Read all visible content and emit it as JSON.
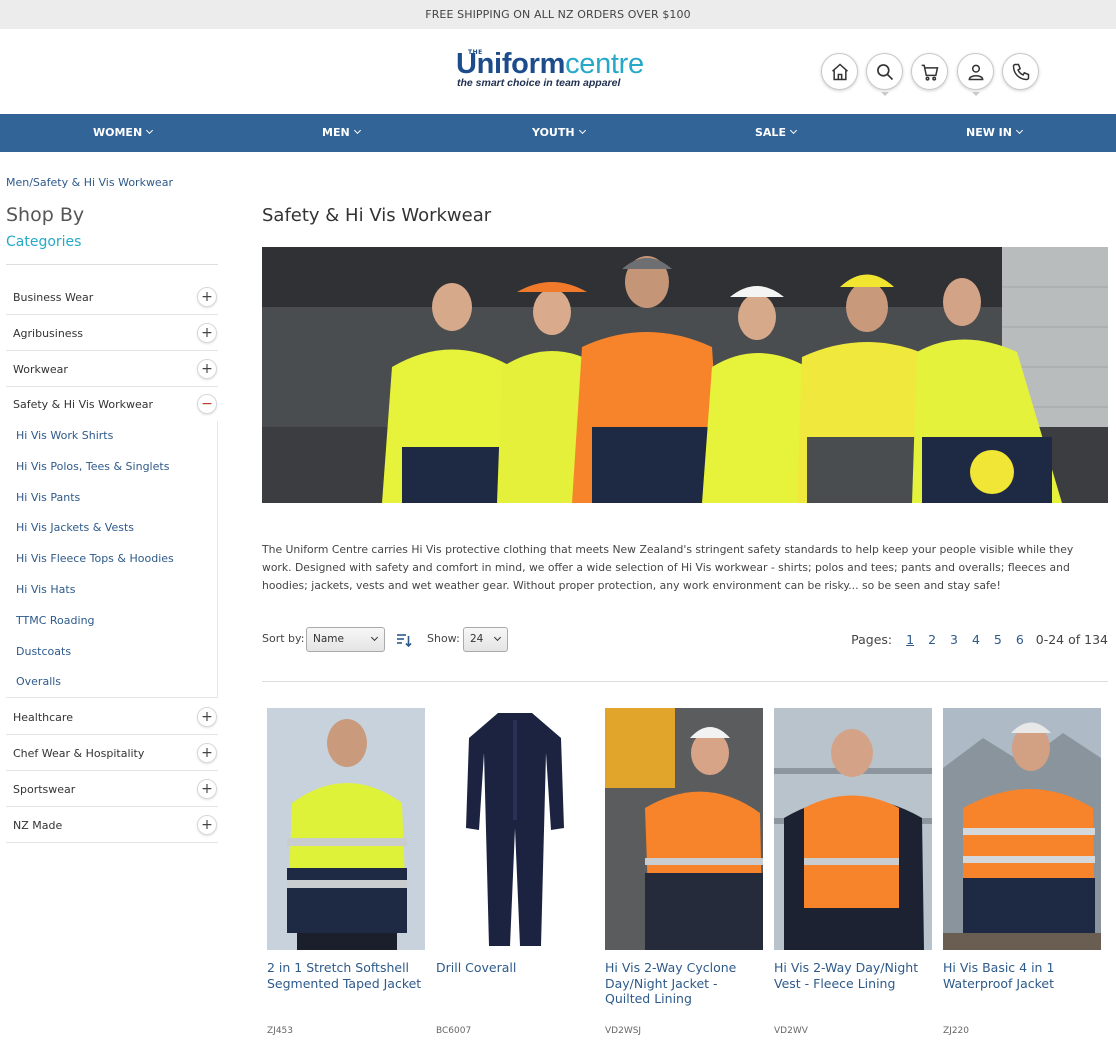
{
  "promo": {
    "text": "FREE SHIPPING ON ALL NZ ORDERS OVER $100"
  },
  "logo": {
    "the": "THE",
    "word1": "Uniform",
    "word2": "centre",
    "tagline": "the smart choice in team apparel"
  },
  "header_icons": [
    "home-icon",
    "search-icon",
    "cart-icon",
    "account-icon",
    "phone-icon"
  ],
  "nav": [
    "WOMEN",
    "MEN",
    "YOUTH",
    "SALE",
    "NEW IN"
  ],
  "breadcrumb": "Men/Safety & Hi Vis Workwear",
  "sidebar": {
    "shop_by": "Shop By",
    "categories_title": "Categories",
    "categories": [
      {
        "label": "Business Wear",
        "toggle": "+"
      },
      {
        "label": "Agribusiness",
        "toggle": "+"
      },
      {
        "label": "Workwear",
        "toggle": "+"
      },
      {
        "label": "Safety & Hi Vis Workwear",
        "toggle": "−"
      },
      {
        "label": "Healthcare",
        "toggle": "+"
      },
      {
        "label": "Chef Wear & Hospitality",
        "toggle": "+"
      },
      {
        "label": "Sportswear",
        "toggle": "+"
      },
      {
        "label": "NZ Made",
        "toggle": "+"
      }
    ],
    "subcategories": [
      "Hi Vis Work Shirts",
      "Hi Vis Polos, Tees & Singlets",
      "Hi Vis Pants",
      "Hi Vis Jackets & Vests",
      "Hi Vis Fleece Tops & Hoodies",
      "Hi Vis Hats",
      "TTMC Roading",
      "Dustcoats",
      "Overalls"
    ]
  },
  "main": {
    "title": "Safety & Hi Vis Workwear",
    "description": "The Uniform Centre carries Hi Vis protective clothing that meets New Zealand's stringent safety standards to help keep your people visible while they work. Designed with safety and comfort in mind, we offer a wide selection of Hi Vis workwear - shirts; polos and tees; pants and overalls; fleeces and hoodies; jackets, vests and wet weather gear. Without proper protection, any work environment can be risky... so be seen and stay safe!"
  },
  "toolbar": {
    "sort_label": "Sort by:",
    "sort_value": "Name",
    "show_label": "Show:",
    "show_value": "24",
    "pages_label": "Pages:",
    "pages": [
      "1",
      "2",
      "3",
      "4",
      "5",
      "6"
    ],
    "range": "0-24 of 134"
  },
  "products": [
    {
      "name": "2 in 1 Stretch Softshell Segmented Taped Jacket",
      "sku": "ZJ453"
    },
    {
      "name": "Drill Coverall",
      "sku": "BC6007"
    },
    {
      "name": "Hi Vis 2-Way Cyclone Day/Night Jacket - Quilted Lining",
      "sku": "VD2WSJ"
    },
    {
      "name": "Hi Vis 2-Way Day/Night Vest - Fleece Lining",
      "sku": "VD2WV"
    },
    {
      "name": "Hi Vis Basic 4 in 1 Waterproof Jacket",
      "sku": "ZJ220"
    }
  ],
  "colors": {
    "nav_bg": "#326497",
    "link": "#2e5a8a",
    "accent": "#26a9c8",
    "hivis_yellow": "#e4f23c",
    "hivis_orange": "#f7842a",
    "navy": "#1e2a44"
  }
}
